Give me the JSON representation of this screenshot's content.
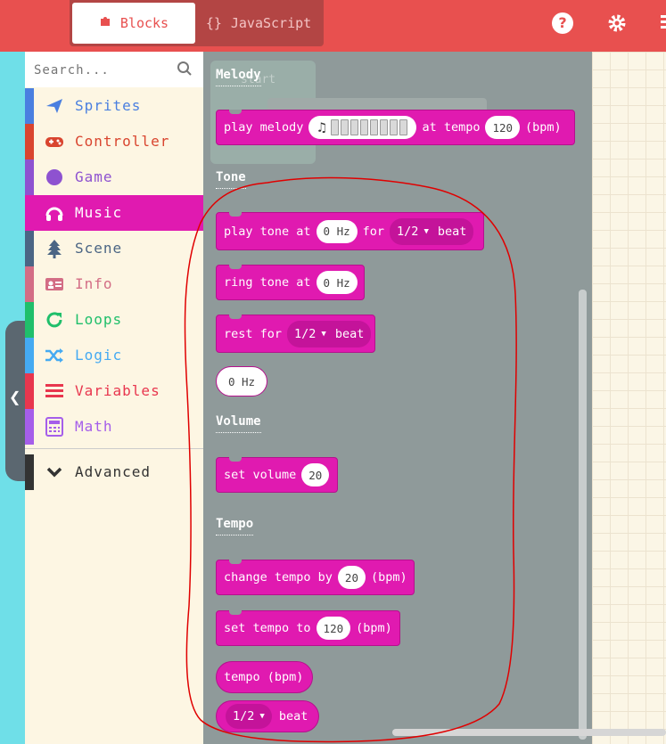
{
  "colors": {
    "accent": "#e8504f",
    "music": "#e01ab0",
    "flyout": "#8f9a9a",
    "annotation": "#e00000"
  },
  "header": {
    "tabs": [
      {
        "label": "Blocks",
        "icon": "puzzle-icon"
      },
      {
        "label": "JavaScript",
        "icon": "braces-icon"
      }
    ],
    "icons": [
      "help-icon",
      "gear-icon",
      "more-icon"
    ],
    "help_glyph": "?",
    "braces_glyph": "{}"
  },
  "search": {
    "placeholder": "Search..."
  },
  "categories": [
    {
      "label": "Sprites",
      "color": "#4a7fe0",
      "icon": "paper-plane-icon"
    },
    {
      "label": "Controller",
      "color": "#d9452f",
      "icon": "gamepad-icon"
    },
    {
      "label": "Game",
      "color": "#8e52d0",
      "icon": "circle-icon"
    },
    {
      "label": "Music",
      "color": "#e01ab0",
      "icon": "headphones-icon",
      "selected": true
    },
    {
      "label": "Scene",
      "color": "#4b6584",
      "icon": "tree-icon"
    },
    {
      "label": "Info",
      "color": "#d36d85",
      "icon": "id-card-icon"
    },
    {
      "label": "Loops",
      "color": "#20bf6b",
      "icon": "refresh-icon"
    },
    {
      "label": "Logic",
      "color": "#45aaf2",
      "icon": "shuffle-icon"
    },
    {
      "label": "Variables",
      "color": "#e8364e",
      "icon": "list-icon"
    },
    {
      "label": "Math",
      "color": "#a55eea",
      "icon": "calculator-icon"
    }
  ],
  "advanced": {
    "label": "Advanced",
    "color": "#333333",
    "icon": "chevron-down-icon"
  },
  "flyout": {
    "ghost_text": "start",
    "sections": {
      "melody": "Melody",
      "tone": "Tone",
      "volume": "Volume",
      "tempo": "Tempo"
    },
    "blocks": {
      "play_melody": {
        "t1": "play melody",
        "t2": "at tempo",
        "v1": "120",
        "t3": "(bpm)",
        "note": "♫"
      },
      "play_tone": {
        "t1": "play tone at",
        "v1": "0 Hz",
        "t2": "for",
        "dd": "1/2",
        "t3": "beat"
      },
      "ring_tone": {
        "t1": "ring tone at",
        "v1": "0 Hz"
      },
      "rest": {
        "t1": "rest for",
        "dd": "1/2",
        "t2": "beat"
      },
      "hz": {
        "v1": "0 Hz"
      },
      "set_volume": {
        "t1": "set volume",
        "v1": "20"
      },
      "change_tempo": {
        "t1": "change tempo by",
        "v1": "20",
        "t2": "(bpm)"
      },
      "set_tempo": {
        "t1": "set tempo to",
        "v1": "120",
        "t2": "(bpm)"
      },
      "tempo": {
        "t1": "tempo (bpm)"
      },
      "beat": {
        "dd": "1/2",
        "t1": "beat"
      }
    }
  },
  "caret": "▼"
}
